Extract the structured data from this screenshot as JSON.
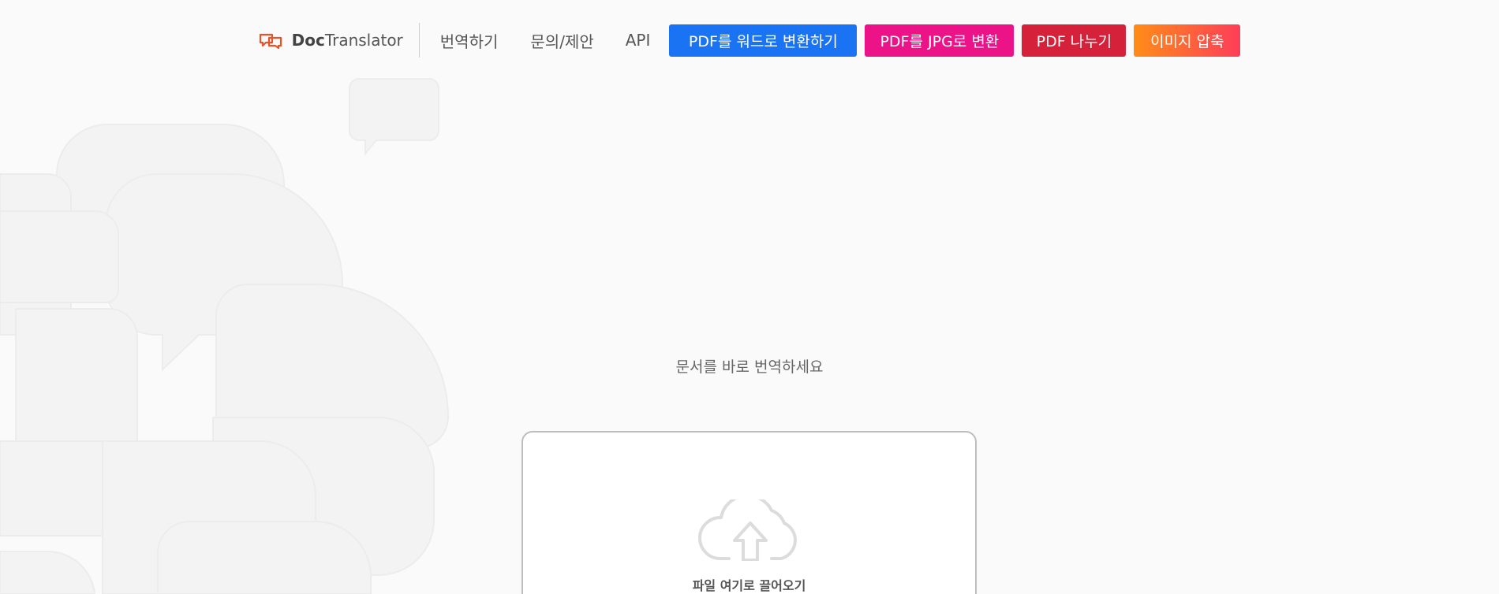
{
  "header": {
    "brand_bold": "Doc",
    "brand_rest": "Translator",
    "nav": [
      {
        "label": "번역하기"
      },
      {
        "label": "문의/제안"
      },
      {
        "label": "API"
      }
    ],
    "tools": [
      {
        "label": "PDF를 워드로 변환하기",
        "color": "#1a73f2"
      },
      {
        "label": "PDF를 JPG로 변환",
        "color": "#ec1288"
      },
      {
        "label": "PDF 나누기",
        "color": "#d6213a"
      },
      {
        "label": "이미지 압축",
        "color": "#ff8d17"
      }
    ]
  },
  "hero": {
    "subtitle": "문서를 바로 번역하세요"
  },
  "upload": {
    "drop_label": "파일 여기로 끌어오기"
  },
  "icons": {
    "brand": "chat-bubbles-logo-icon",
    "upload": "cloud-upload-icon"
  },
  "colors": {
    "brand_icon": "#e8542a",
    "page_background": "#fafafa"
  }
}
